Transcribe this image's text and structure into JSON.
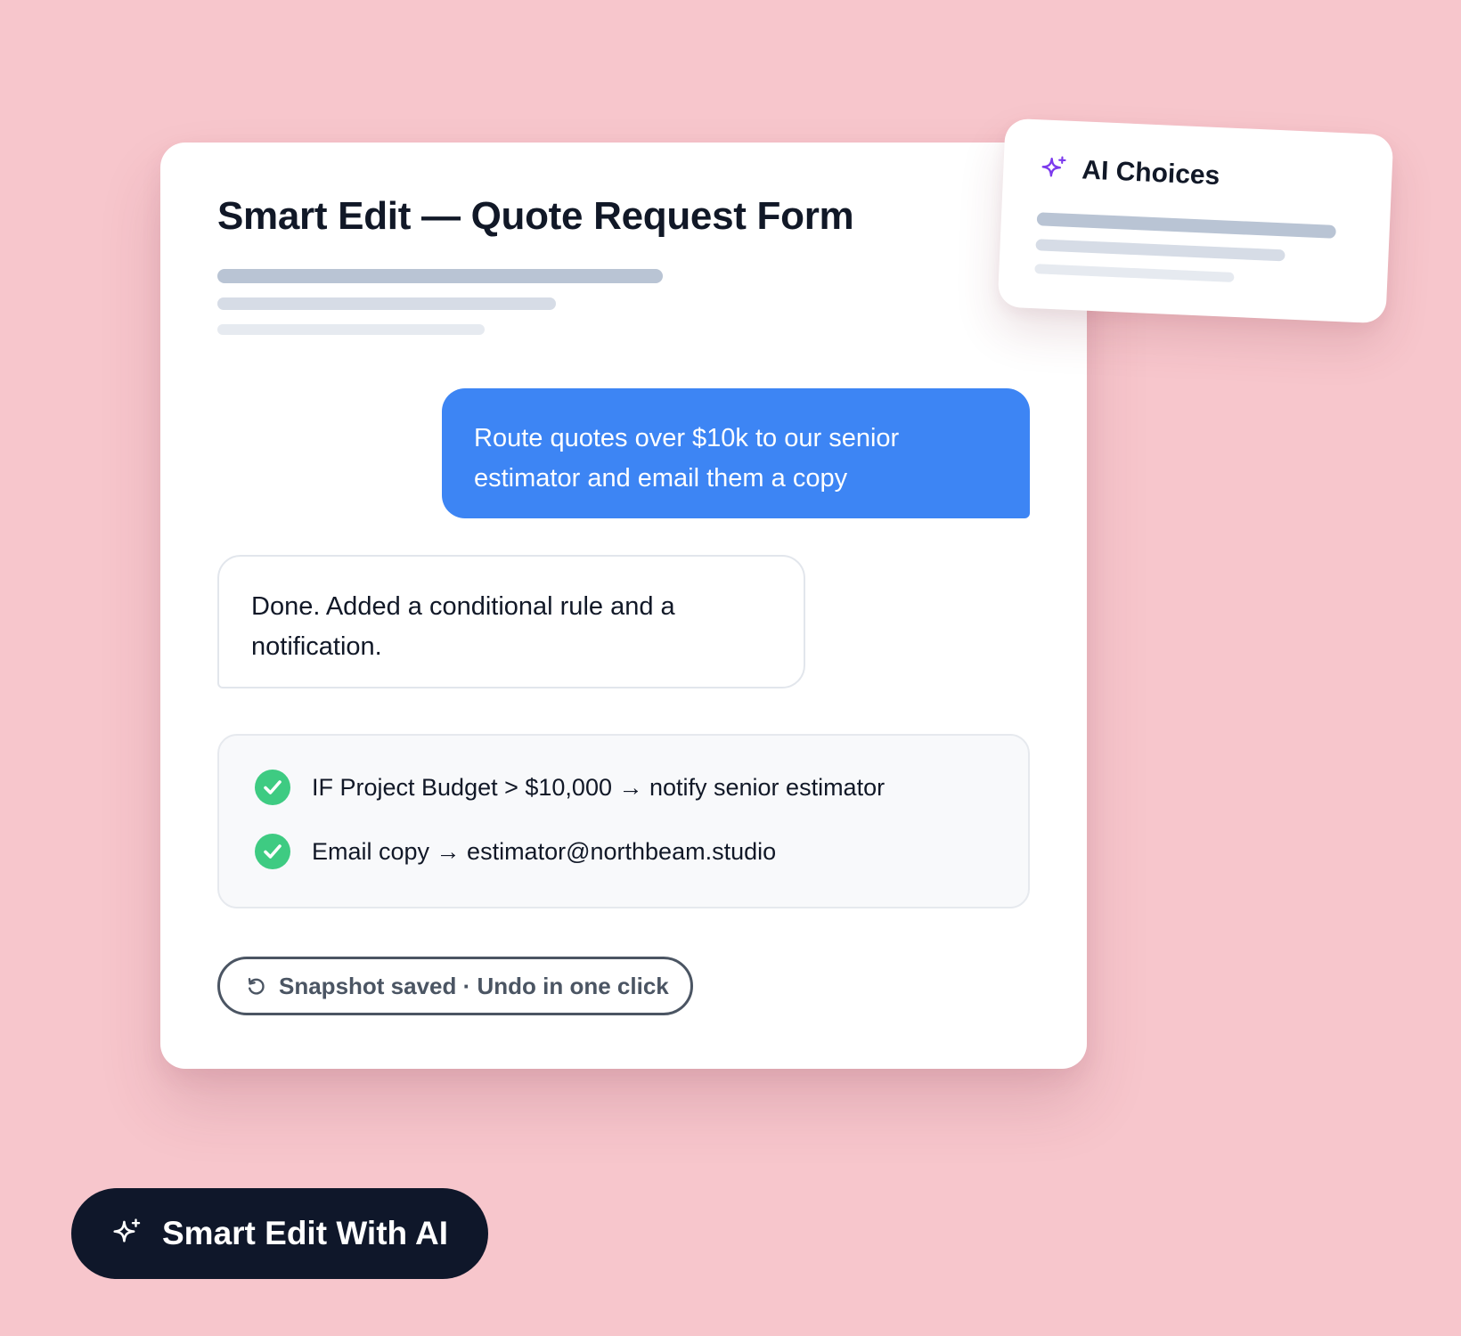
{
  "main_card": {
    "title": "Smart Edit — Quote Request Form",
    "user_message": "Route quotes over $10k to our senior estimator and email them a copy",
    "ai_reply": "Done. Added a conditional rule and a notification.",
    "rules": [
      {
        "text": "IF Project Budget > $10,000 → notify senior estimator",
        "icon": "check-circle-icon"
      },
      {
        "text": "Email copy → estimator@northbeam.studio",
        "icon": "check-circle-icon"
      }
    ],
    "snapshot_label": "Snapshot saved · Undo in one click",
    "snapshot_icon": "undo-icon"
  },
  "choices_card": {
    "title": "AI Choices",
    "icon": "sparkle-icon"
  },
  "cta": {
    "label": "Smart Edit With AI",
    "icon": "sparkle-icon"
  },
  "colors": {
    "background": "#f7c6cc",
    "user_bubble": "#3d85f4",
    "success_check": "#3ecb82",
    "sparkle_accent": "#7c3aed",
    "cta_background": "#0f172a"
  }
}
